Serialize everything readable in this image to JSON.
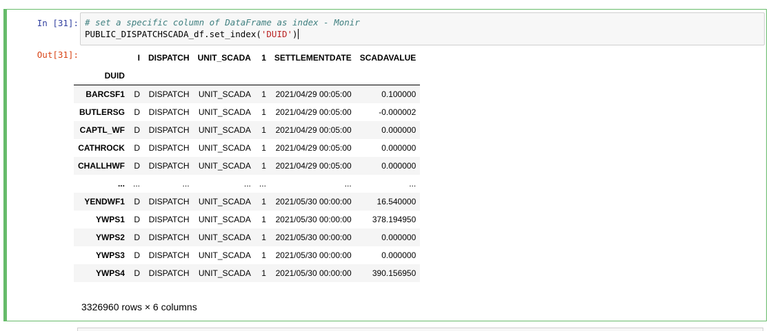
{
  "cell": {
    "in_prompt": "In [31]:",
    "out_prompt": "Out[31]:",
    "code": {
      "comment": "# set a specific column of DataFrame as index - Monir",
      "line2_prefix": "PUBLIC_DISPATCHSCADA_df.set_index(",
      "line2_string": "'DUID'",
      "line2_suffix": ")"
    }
  },
  "dataframe": {
    "columns": [
      "I",
      "DISPATCH",
      "UNIT_SCADA",
      "1",
      "SETTLEMENTDATE",
      "SCADAVALUE"
    ],
    "index_name": "DUID",
    "rows": [
      {
        "index": "BARCSF1",
        "cells": [
          "D",
          "DISPATCH",
          "UNIT_SCADA",
          "1",
          "2021/04/29 00:05:00",
          "0.100000"
        ]
      },
      {
        "index": "BUTLERSG",
        "cells": [
          "D",
          "DISPATCH",
          "UNIT_SCADA",
          "1",
          "2021/04/29 00:05:00",
          "-0.000002"
        ]
      },
      {
        "index": "CAPTL_WF",
        "cells": [
          "D",
          "DISPATCH",
          "UNIT_SCADA",
          "1",
          "2021/04/29 00:05:00",
          "0.000000"
        ]
      },
      {
        "index": "CATHROCK",
        "cells": [
          "D",
          "DISPATCH",
          "UNIT_SCADA",
          "1",
          "2021/04/29 00:05:00",
          "0.000000"
        ]
      },
      {
        "index": "CHALLHWF",
        "cells": [
          "D",
          "DISPATCH",
          "UNIT_SCADA",
          "1",
          "2021/04/29 00:05:00",
          "0.000000"
        ]
      },
      {
        "index": "...",
        "cells": [
          "...",
          "...",
          "...",
          "...",
          "...",
          "..."
        ]
      },
      {
        "index": "YENDWF1",
        "cells": [
          "D",
          "DISPATCH",
          "UNIT_SCADA",
          "1",
          "2021/05/30 00:00:00",
          "16.540000"
        ]
      },
      {
        "index": "YWPS1",
        "cells": [
          "D",
          "DISPATCH",
          "UNIT_SCADA",
          "1",
          "2021/05/30 00:00:00",
          "378.194950"
        ]
      },
      {
        "index": "YWPS2",
        "cells": [
          "D",
          "DISPATCH",
          "UNIT_SCADA",
          "1",
          "2021/05/30 00:00:00",
          "0.000000"
        ]
      },
      {
        "index": "YWPS3",
        "cells": [
          "D",
          "DISPATCH",
          "UNIT_SCADA",
          "1",
          "2021/05/30 00:00:00",
          "0.000000"
        ]
      },
      {
        "index": "YWPS4",
        "cells": [
          "D",
          "DISPATCH",
          "UNIT_SCADA",
          "1",
          "2021/05/30 00:00:00",
          "390.156950"
        ]
      }
    ],
    "shape_text": "3326960 rows × 6 columns"
  },
  "colors": {
    "cell_border_active": "#66bb6a",
    "in_prompt": "#303f9f",
    "out_prompt": "#d84315",
    "comment": "#408080",
    "string": "#ba2121"
  }
}
